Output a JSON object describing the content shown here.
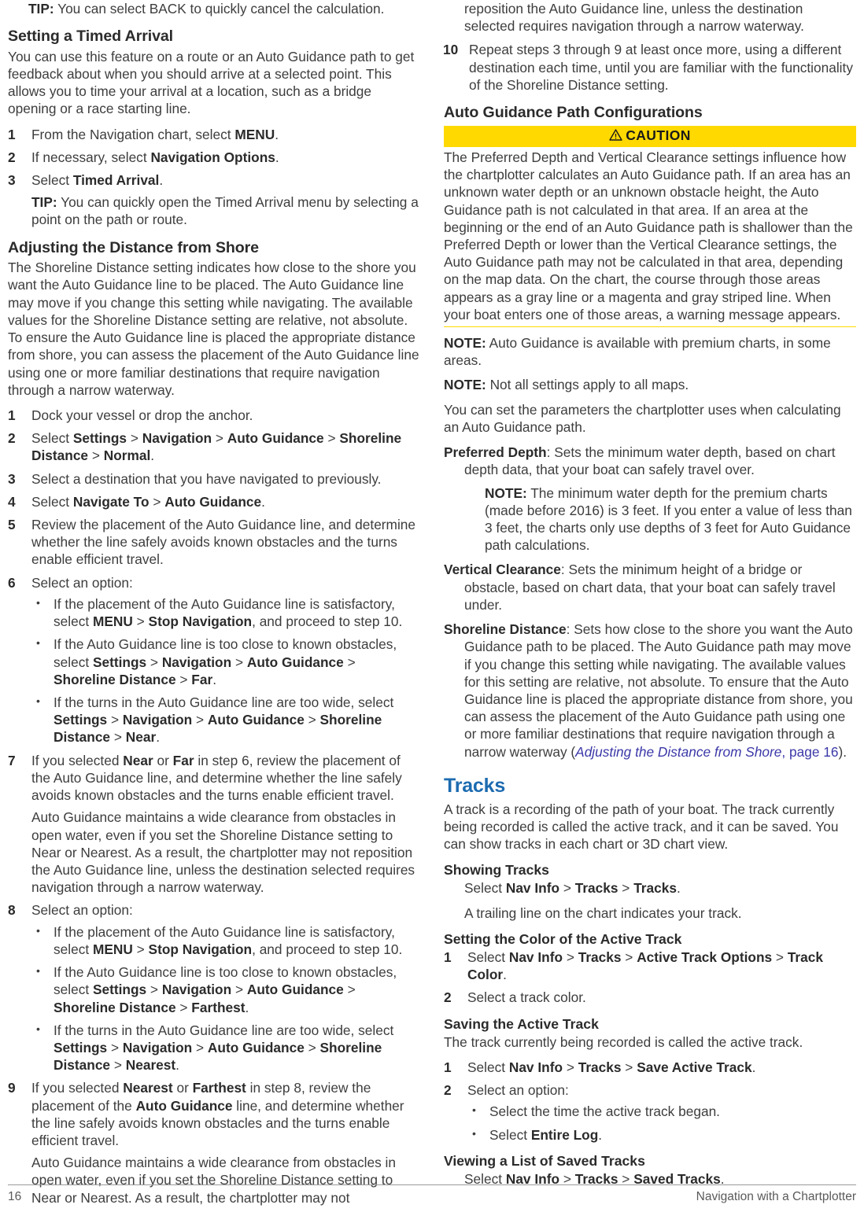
{
  "document": {
    "page_number": "16",
    "footer_title": "Navigation with a Chartplotter"
  },
  "left_column": {
    "tip_top": {
      "label": "TIP:",
      "text": " You can select BACK to quickly cancel the calculation."
    },
    "timed_arrival": {
      "heading": "Setting a Timed Arrival",
      "intro": "You can use this feature on a route or an Auto Guidance path to get feedback about when you should arrive at a selected point. This allows you to time your arrival at a location, such as a bridge opening or a race starting line.",
      "steps": [
        {
          "num": "1",
          "pre": "From the Navigation chart, select ",
          "bold": "MENU",
          "post": "."
        },
        {
          "num": "2",
          "pre": "If necessary, select ",
          "bold": "Navigation Options",
          "post": "."
        },
        {
          "num": "3",
          "pre": "Select ",
          "bold": "Timed Arrival",
          "post": "."
        }
      ],
      "tip": {
        "label": "TIP:",
        "text": " You can quickly open the Timed Arrival menu by selecting a point on the path or route."
      }
    },
    "shore_distance": {
      "heading": "Adjusting the Distance from Shore",
      "intro": "The Shoreline Distance setting indicates how close to the shore you want the Auto Guidance line to be placed. The Auto Guidance line may move if you change this setting while navigating. The available values for the Shoreline Distance setting are relative, not absolute. To ensure the Auto Guidance line is placed the appropriate distance from shore, you can assess the placement of the Auto Guidance line using one or more familiar destinations that require navigation through a narrow waterway.",
      "step1": {
        "num": "1",
        "text": "Dock your vessel or drop the anchor."
      },
      "step2": {
        "num": "2",
        "pre": "Select ",
        "path": [
          "Settings",
          "Navigation",
          "Auto Guidance",
          "Shoreline Distance",
          "Normal"
        ],
        "post": "."
      },
      "step3": {
        "num": "3",
        "text": "Select a destination that you have navigated to previously."
      },
      "step4": {
        "num": "4",
        "pre": "Select ",
        "path": [
          "Navigate To",
          "Auto Guidance"
        ],
        "post": "."
      },
      "step5": {
        "num": "5",
        "text": "Review the placement of the Auto Guidance line, and determine whether the line safely avoids known obstacles and the turns enable efficient travel."
      },
      "step6": {
        "num": "6",
        "lead": "Select an option:",
        "bullets": [
          {
            "pre": "If the placement of the Auto Guidance line is satisfactory, select ",
            "b1": "MENU",
            "mid": " > ",
            "b2": "Stop Navigation",
            "post": ", and proceed to step 10."
          },
          {
            "pre": "If the Auto Guidance line is too close to known obstacles, select ",
            "path": [
              "Settings",
              "Navigation",
              "Auto Guidance",
              "Shoreline Distance",
              "Far"
            ],
            "post": "."
          },
          {
            "pre": "If the turns in the Auto Guidance line are too wide, select ",
            "path": [
              "Settings",
              "Navigation",
              "Auto Guidance",
              "Shoreline Distance",
              "Near"
            ],
            "post": "."
          }
        ]
      },
      "step7": {
        "num": "7",
        "pre": "If you selected ",
        "b1": "Near",
        "mid": " or ",
        "b2": "Far",
        "post": " in step 6, review the placement of the Auto Guidance line, and determine whether the line safely avoids known obstacles and the turns enable efficient travel.",
        "note": "Auto Guidance maintains a wide clearance from obstacles in open water, even if you set the Shoreline Distance setting to Near or Nearest. As a result, the chartplotter may not reposition the Auto Guidance line, unless the destination selected requires navigation through a narrow waterway."
      },
      "step8": {
        "num": "8",
        "lead": "Select an option:",
        "bullets": [
          {
            "pre": "If the placement of the Auto Guidance line is satisfactory, select ",
            "b1": "MENU",
            "mid": " > ",
            "b2": "Stop Navigation",
            "post": ", and proceed to step 10."
          },
          {
            "pre": "If the Auto Guidance line is too close to known obstacles, select ",
            "path": [
              "Settings",
              "Navigation",
              "Auto Guidance",
              "Shoreline Distance",
              "Farthest"
            ],
            "post": "."
          },
          {
            "pre": "If the turns in the Auto Guidance line are too wide, select ",
            "path": [
              "Settings",
              "Navigation",
              "Auto Guidance",
              "Shoreline Distance",
              "Nearest"
            ],
            "post": "."
          }
        ]
      },
      "step9": {
        "num": "9",
        "pre": "If you selected ",
        "b1": "Nearest",
        "mid": " or ",
        "b2": "Farthest",
        "mid2": " in step 8, review the placement of the ",
        "b3": "Auto Guidance",
        "post": " line, and determine whether the line safely avoids known obstacles and the turns enable efficient travel.",
        "note": "Auto Guidance maintains a wide clearance from obstacles in open water, even if you set the Shoreline Distance setting to Near or Nearest. As a result, the chartplotter may not"
      }
    }
  },
  "right_column": {
    "continuation": "reposition the Auto Guidance line, unless the destination selected requires navigation through a narrow waterway.",
    "step10": {
      "num": "10",
      "text": "Repeat steps 3 through 9 at least once more, using a different destination each time, until you are familiar with the functionality of the Shoreline Distance setting."
    },
    "path_config": {
      "heading": "Auto Guidance Path Configurations",
      "caution": {
        "icon": "warning-triangle-icon",
        "label": "CAUTION",
        "body": "The Preferred Depth and Vertical Clearance settings influence how the chartplotter calculates an Auto Guidance path. If an area has an unknown water depth or an unknown obstacle height, the Auto Guidance path is not calculated in that area. If an area at the beginning or the end of an Auto Guidance path is shallower than the Preferred Depth or lower than the Vertical Clearance settings, the Auto Guidance path may not be calculated in that area, depending on the map data. On the chart, the course through those areas appears as a gray line or a magenta and gray striped line. When your boat enters one of those areas, a warning message appears."
      },
      "note1": {
        "label": "NOTE:",
        "text": " Auto Guidance is available with premium charts, in some areas."
      },
      "note2": {
        "label": "NOTE:",
        "text": " Not all settings apply to all maps."
      },
      "intro": "You can set the parameters the chartplotter uses when calculating an Auto Guidance path.",
      "definitions": [
        {
          "term": "Preferred Depth",
          "text": ": Sets the minimum water depth, based on chart depth data, that your boat can safely travel over.",
          "subnote": {
            "label": "NOTE:",
            "text": " The minimum water depth for the premium charts (made before 2016) is 3 feet. If you enter a value of less than 3 feet, the charts only use depths of 3 feet for Auto Guidance path calculations."
          }
        },
        {
          "term": "Vertical Clearance",
          "text": ": Sets the minimum height of a bridge or obstacle, based on chart data, that your boat can safely travel under."
        },
        {
          "term": "Shoreline Distance",
          "text": ": Sets how close to the shore you want the Auto Guidance path to be placed. The Auto Guidance path may move if you change this setting while navigating. The available values for this setting are relative, not absolute. To ensure that the Auto Guidance line is placed the appropriate distance from shore, you can assess the placement of the Auto Guidance path using one or more familiar destinations that require navigation through a narrow waterway (",
          "xref_title": "Adjusting the Distance from Shore",
          "xref_page": ", page 16",
          "text_end": ")."
        }
      ]
    },
    "tracks": {
      "heading": "Tracks",
      "intro": "A track is a recording of the path of your boat. The track currently being recorded is called the active track, and it can be saved. You can show tracks in each chart or 3D chart view.",
      "showing_tracks": {
        "heading": "Showing Tracks",
        "select_pre": "Select ",
        "path": [
          "Nav Info",
          "Tracks",
          "Tracks"
        ],
        "select_post": ".",
        "result": "A trailing line on the chart indicates your track."
      },
      "setting_color": {
        "heading": "Setting the Color of the Active Track",
        "step1": {
          "num": "1",
          "pre": "Select ",
          "path": [
            "Nav Info",
            "Tracks",
            "Active Track Options",
            "Track Color"
          ],
          "post": "."
        },
        "step2": {
          "num": "2",
          "text": "Select a track color."
        }
      },
      "saving_track": {
        "heading": "Saving the Active Track",
        "intro": "The track currently being recorded is called the active track.",
        "step1": {
          "num": "1",
          "pre": "Select ",
          "path": [
            "Nav Info",
            "Tracks",
            "Save Active Track"
          ],
          "post": "."
        },
        "step2": {
          "num": "2",
          "lead": "Select an option:",
          "bullets": [
            {
              "pre": "Select the time the active track began."
            },
            {
              "pre": "Select ",
              "b1": "Entire Log",
              "post": "."
            }
          ]
        }
      },
      "viewing_saved": {
        "heading": "Viewing a List of Saved Tracks",
        "select_pre": "Select ",
        "path": [
          "Nav Info",
          "Tracks",
          "Saved Tracks"
        ],
        "select_post": "."
      }
    }
  },
  "colors": {
    "caution_yellow": "#FFD900",
    "heading_blue": "#1C6BB0",
    "xref_blue": "#3B38A8",
    "body_gray": "#3d3d3d"
  }
}
